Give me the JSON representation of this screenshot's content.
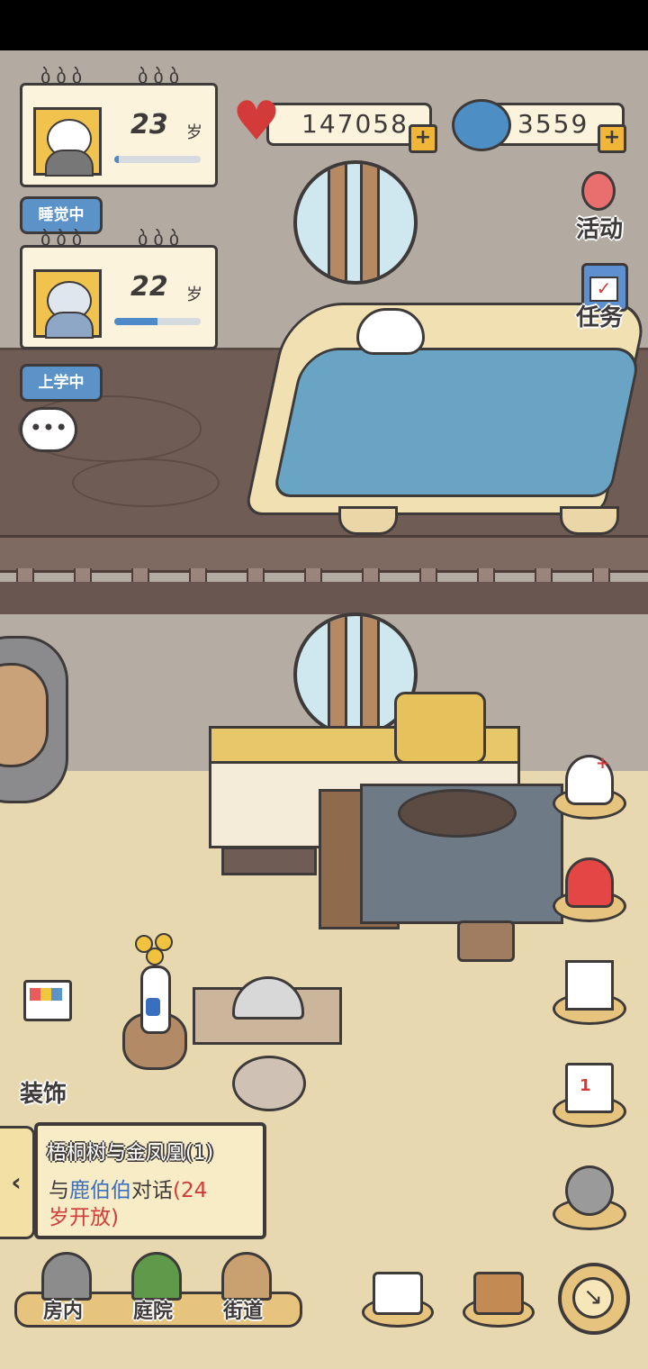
{
  "characters": [
    {
      "age": "23",
      "unit": "岁",
      "status": "睡觉中",
      "progress": 0.05
    },
    {
      "age": "22",
      "unit": "岁",
      "status": "上学中",
      "progress": 0.5
    }
  ],
  "currency": {
    "hearts": "147058",
    "gems": "3559"
  },
  "side_menu": {
    "activity": "活动",
    "tasks": "任务"
  },
  "decorate": {
    "label": "装饰"
  },
  "quest": {
    "title": "梧桐树与金凤凰(1)",
    "line1_prefix": "与",
    "line1_name": "鹿伯伯",
    "line1_suffix": "对话",
    "line1_open": "(24",
    "line2": "岁开放)",
    "tab_arrow": "‹"
  },
  "nav": {
    "room": "房内",
    "yard": "庭院",
    "street": "街道"
  },
  "icons": {
    "chat": "chat-bubble-icon",
    "heart": "heart-icon",
    "gem": "gem-icon",
    "plus": "+",
    "podium_number": "1",
    "panda_mark": "+"
  }
}
